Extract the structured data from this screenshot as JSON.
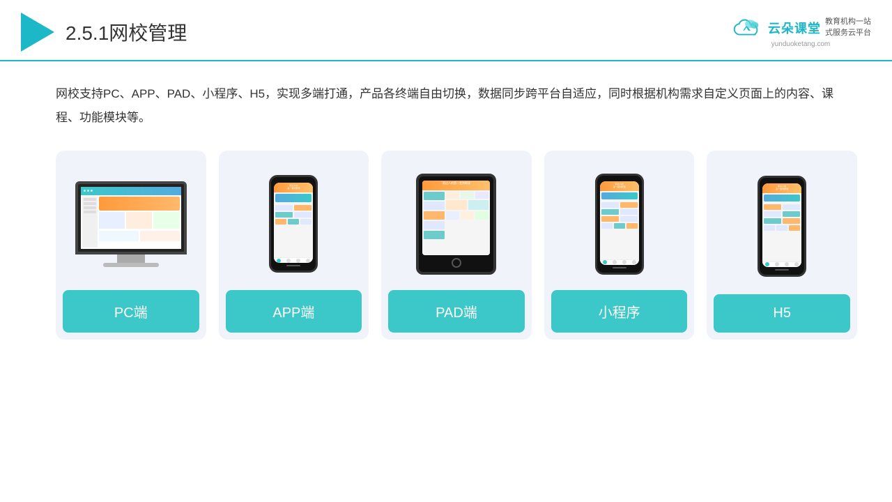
{
  "header": {
    "title_prefix": "2.5.1",
    "title_main": "网校管理",
    "brand_name": "云朵课堂",
    "brand_url": "yunduoketang.com",
    "brand_slogan_line1": "教育机构一站",
    "brand_slogan_line2": "式服务云平台"
  },
  "description": {
    "text": "网校支持PC、APP、PAD、小程序、H5，实现多端打通，产品各终端自由切换，数据同步跨平台自适应，同时根据机构需求自定义页面上的内容、课程、功能模块等。"
  },
  "cards": [
    {
      "id": "pc",
      "label": "PC端"
    },
    {
      "id": "app",
      "label": "APP端"
    },
    {
      "id": "pad",
      "label": "PAD端"
    },
    {
      "id": "miniapp",
      "label": "小程序"
    },
    {
      "id": "h5",
      "label": "H5"
    }
  ]
}
